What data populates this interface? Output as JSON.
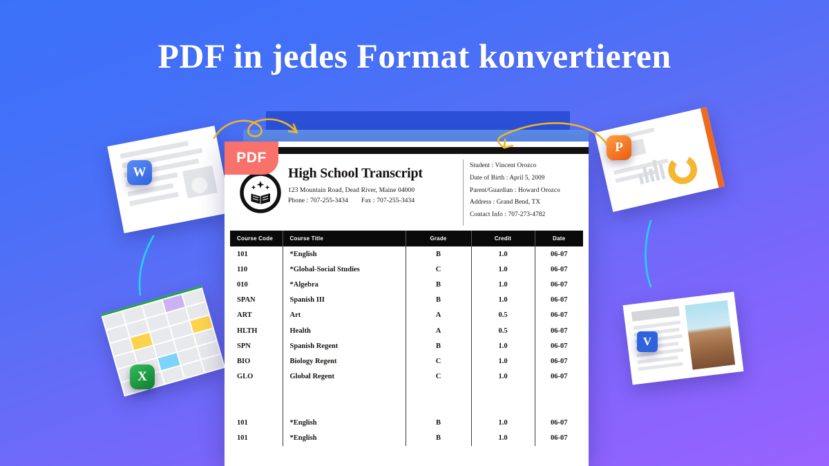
{
  "headline": "PDF in jedes Format konvertieren",
  "colors": {
    "bg_top": "#3b71fa",
    "bg_bottom": "#9a62ff",
    "pdf_badge": "#f8716a",
    "arrow": "#f0b429",
    "arc": "#22d3ee",
    "word_blue": "#2f62dd",
    "excel_green": "#23a345",
    "ppt_orange": "#ee6a1e"
  },
  "pdf_badge": {
    "label": "PDF"
  },
  "document": {
    "school": {
      "title": "High School Transcript",
      "address": "123 Mountain Road, Dead River, Maine 04000",
      "phone_label": "Phone :",
      "phone": "707-255-3434",
      "fax_label": "Fax :",
      "fax": "707-255-3434",
      "seal_icon": "open-book-seal-icon"
    },
    "student_info": [
      "Student : Vincent Orozco",
      "Date of Birth : April 5,  2009",
      "Parent/Guardian : Howard Orozco",
      "Address : Grand Bend, TX",
      "Contact Info : 707-273-4782"
    ],
    "table": {
      "columns": [
        "Course Code",
        "Course Title",
        "Grade",
        "Credit",
        "Date"
      ],
      "rows": [
        [
          "101",
          "*English",
          "B",
          "1.0",
          "06-07"
        ],
        [
          "110",
          "*Global-Social Studies",
          "C",
          "1.0",
          "06-07"
        ],
        [
          "010",
          "*Algebra",
          "B",
          "1.0",
          "06-07"
        ],
        [
          "SPAN",
          "Spanish III",
          "B",
          "1.0",
          "06-07"
        ],
        [
          "ART",
          "Art",
          "A",
          "0.5",
          "06-07"
        ],
        [
          "HLTH",
          "Health",
          "A",
          "0.5",
          "06-07"
        ],
        [
          "SPN",
          "Spanish Regent",
          "B",
          "1.0",
          "06-07"
        ],
        [
          "BIO",
          "Biology Regent",
          "C",
          "1.0",
          "06-07"
        ],
        [
          "GLO",
          "Global Regent",
          "C",
          "1.0",
          "06-07"
        ]
      ],
      "rows_after_gap": [
        [
          "101",
          "*English",
          "B",
          "1.0",
          "06-07"
        ],
        [
          "101",
          "*English",
          "B",
          "1.0",
          "06-07"
        ]
      ]
    }
  },
  "file_icons": {
    "word": {
      "badge": "W",
      "name": "word-document-icon"
    },
    "excel": {
      "badge": "X",
      "name": "excel-spreadsheet-icon"
    },
    "powerpoint": {
      "badge": "P",
      "name": "powerpoint-slide-icon"
    },
    "image_doc": {
      "badge": "V",
      "name": "image-document-icon"
    }
  }
}
